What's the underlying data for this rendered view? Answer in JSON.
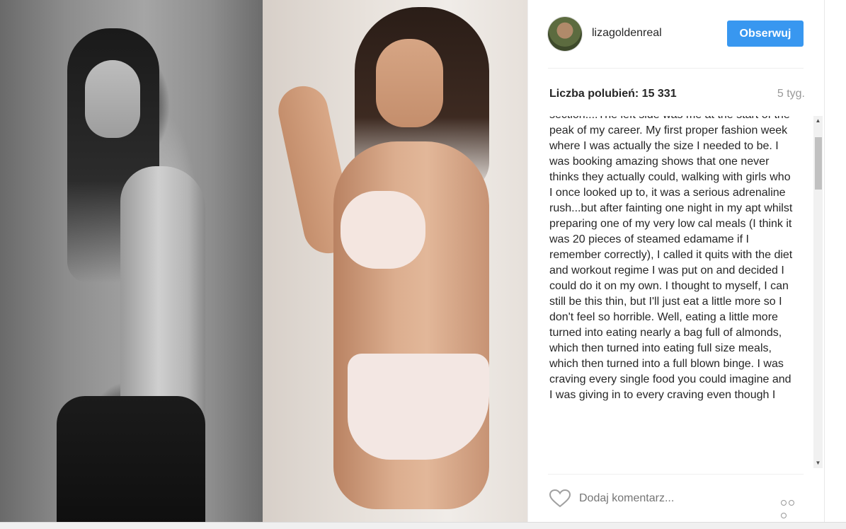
{
  "post": {
    "username": "lizagoldenreal",
    "follow_label": "Obserwuj",
    "likes_text": "Liczba polubień: 15 331",
    "time_ago": "5 tyg.",
    "caption": "section....The left side was me at the start of the peak of my career. My first proper fashion week where I was actually the size I needed to be. I was booking amazing shows that one never thinks they actually could, walking with girls who I once looked up to, it was a serious adrenaline rush...but after fainting one night in my apt whilst preparing one of my very low cal meals (I think it was 20 pieces of steamed edamame if I remember correctly), I called it quits with the diet and workout regime I was put on and decided I could do it on my own. I thought to myself, I can still be this thin, but I'll just eat a little more so I don't feel so horrible. Well, eating a little more turned into eating nearly a bag full of almonds, which then turned into eating full size meals, which then turned into a full blown binge. I was craving every single food you could imagine and I was giving in to every craving even though I",
    "comment_placeholder": "Dodaj komentarz...",
    "scroll_up": "▲",
    "scroll_down": "▼"
  },
  "icons": {
    "heart": "heart-icon",
    "more": "more-options-icon",
    "avatar": "avatar"
  },
  "colors": {
    "follow_button": "#3897f0",
    "text": "#262626",
    "muted": "#999999"
  }
}
